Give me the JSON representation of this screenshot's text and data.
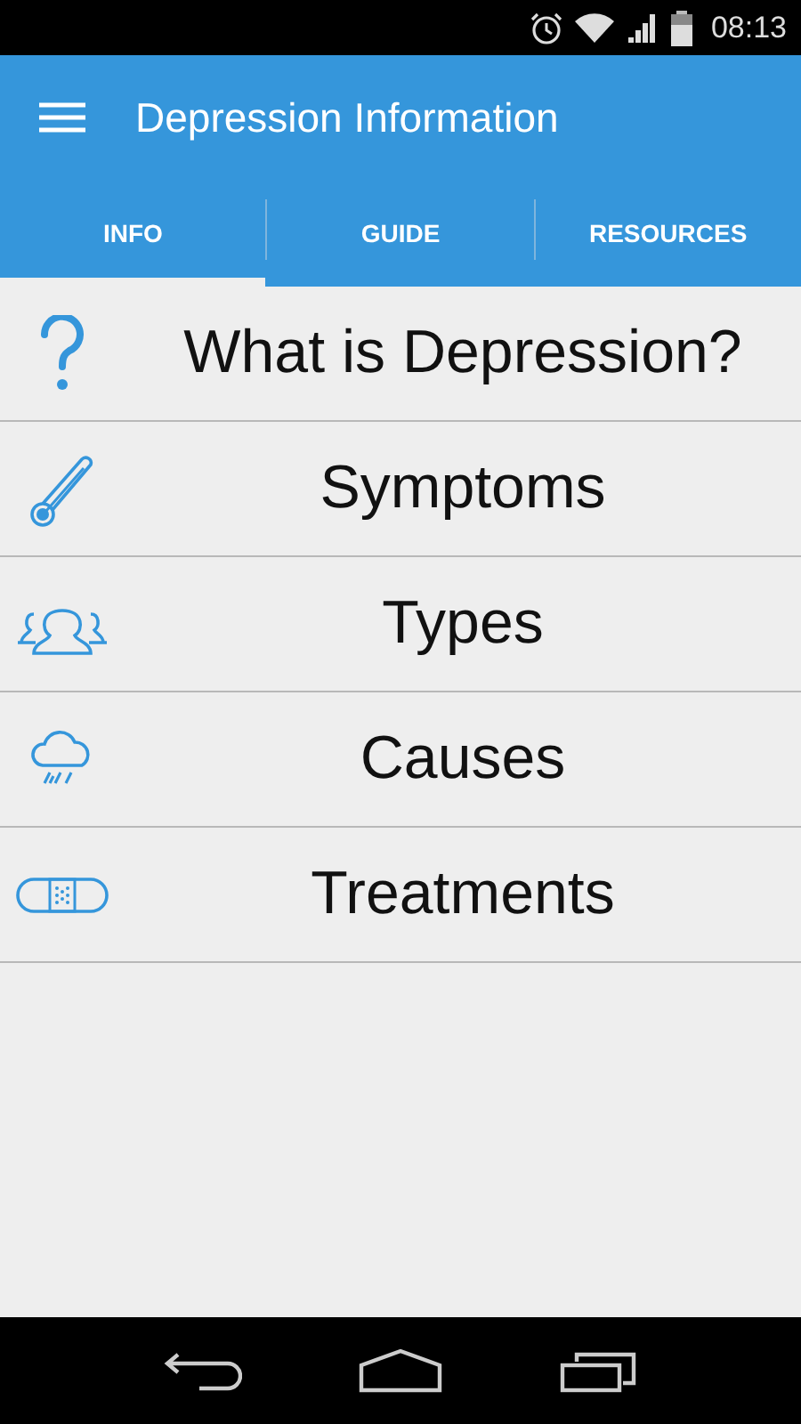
{
  "status_bar": {
    "time": "08:13"
  },
  "app_bar": {
    "title": "Depression Information"
  },
  "tabs": [
    {
      "label": "INFO",
      "selected": true
    },
    {
      "label": "GUIDE",
      "selected": false
    },
    {
      "label": "RESOURCES",
      "selected": false
    }
  ],
  "items": [
    {
      "label": "What is Depression?",
      "kind": "question"
    },
    {
      "label": "Symptoms",
      "kind": "thermometer"
    },
    {
      "label": "Types",
      "kind": "people"
    },
    {
      "label": "Causes",
      "kind": "rain"
    },
    {
      "label": "Treatments",
      "kind": "bandage"
    }
  ]
}
